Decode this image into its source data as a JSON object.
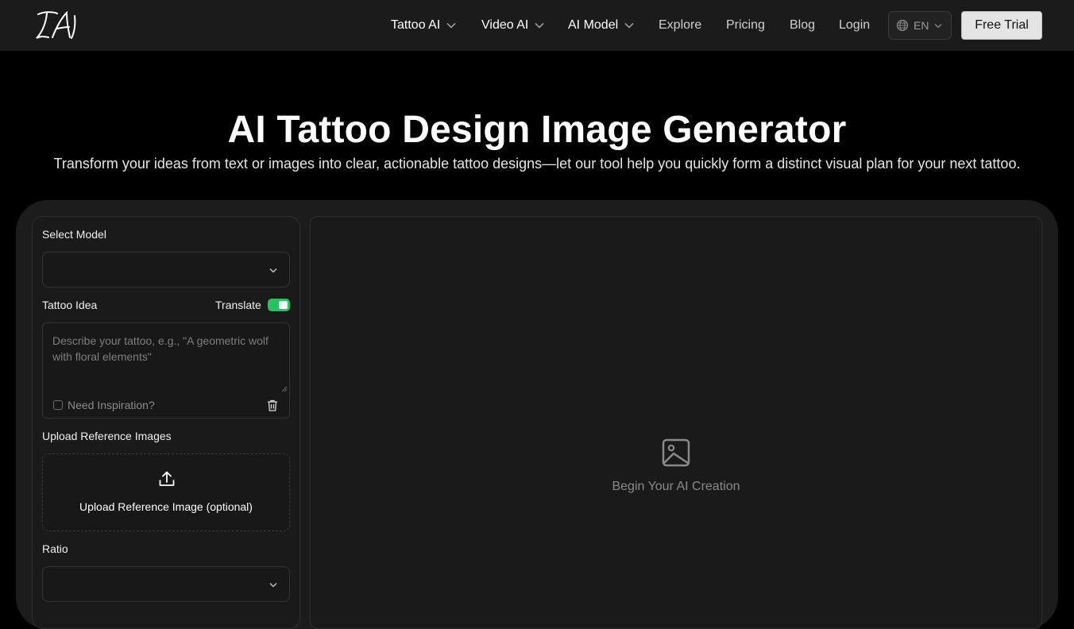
{
  "header": {
    "logo_text": "TAI",
    "nav": [
      {
        "label": "Tattoo AI",
        "dropdown": true
      },
      {
        "label": "Video AI",
        "dropdown": true
      },
      {
        "label": "AI Model",
        "dropdown": true
      },
      {
        "label": "Explore",
        "dropdown": false
      },
      {
        "label": "Pricing",
        "dropdown": false
      },
      {
        "label": "Blog",
        "dropdown": false
      },
      {
        "label": "Login",
        "dropdown": false
      }
    ],
    "language": "EN",
    "cta": "Free Trial"
  },
  "hero": {
    "title": "AI Tattoo Design Image Generator",
    "subtitle": "Transform your ideas from text or images into clear, actionable tattoo designs—let our tool help you quickly form a distinct visual plan for your next tattoo."
  },
  "form": {
    "model_label": "Select Model",
    "model_value": "",
    "idea_label": "Tattoo Idea",
    "translate_label": "Translate",
    "translate_on": true,
    "idea_placeholder": "Describe your tattoo, e.g., \"A geometric wolf with floral elements\"",
    "inspiration_label": "Need Inspiration?",
    "upload_label": "Upload Reference Images",
    "upload_button": "Upload Reference Image (optional)",
    "ratio_label": "Ratio",
    "ratio_value": ""
  },
  "preview": {
    "empty_text": "Begin Your AI Creation"
  },
  "colors": {
    "accent_green": "#22c55e",
    "background": "#000000",
    "panel": "#1c1c1c"
  }
}
